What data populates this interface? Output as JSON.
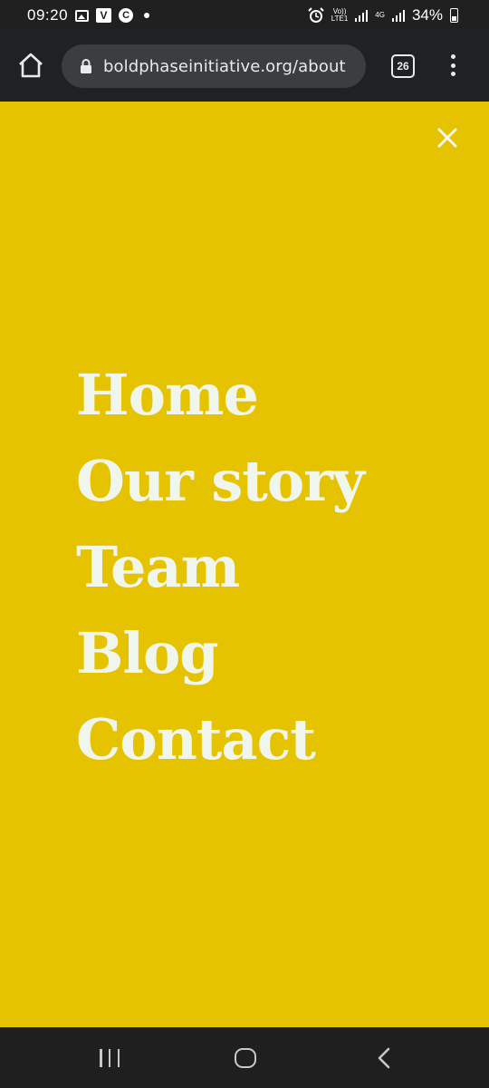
{
  "status_bar": {
    "time": "09:20",
    "volte_label": "Vo))",
    "lte_label": "LTE1",
    "network_label": "4G",
    "battery_percent": "34%",
    "icons": [
      "gallery-icon",
      "v-app-icon",
      "c-app-icon",
      "dot-icon",
      "alarm-icon",
      "signal-icon",
      "battery-icon"
    ]
  },
  "browser": {
    "url": "boldphaseinitiative.org/about",
    "tab_count": "26",
    "icons": [
      "home-icon",
      "lock-icon",
      "tabs-icon",
      "more-vert-icon"
    ],
    "background": "#202124",
    "url_bar_background": "#3c3d40"
  },
  "page": {
    "background": "#e6c300",
    "text_color": "#f1f6ec",
    "close_icon": "close-icon",
    "menu": [
      {
        "label": "Home"
      },
      {
        "label": "Our story"
      },
      {
        "label": "Team"
      },
      {
        "label": "Blog"
      },
      {
        "label": "Contact"
      }
    ]
  },
  "system_nav": {
    "icons": [
      "recents-icon",
      "home-button-icon",
      "back-icon"
    ]
  }
}
